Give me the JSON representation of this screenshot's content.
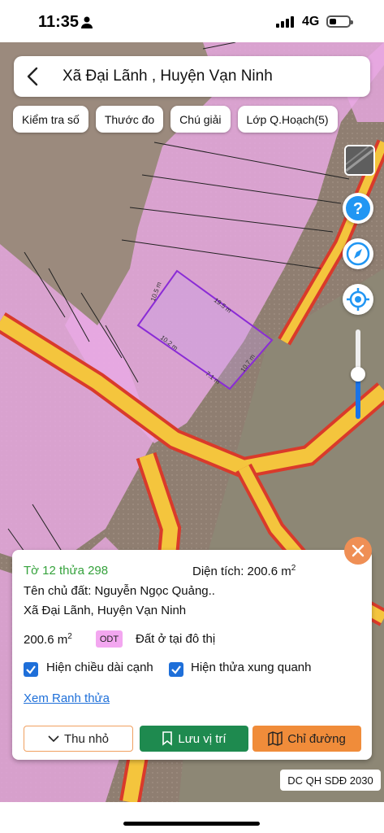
{
  "status_bar": {
    "time": "11:35",
    "network": "4G"
  },
  "header": {
    "title": "Xã Đại Lãnh , Huyện Vạn Ninh"
  },
  "toolbar_chips": [
    "Kiểm tra số",
    "Thước đo",
    "Chú giải",
    "Lớp Q.Hoạch(5)"
  ],
  "map_dimensions": [
    "10.5 m",
    "19.5 m",
    "10.2 m",
    "7.1 m",
    "10.7 m"
  ],
  "zoom_level": 0.5,
  "parcel_info": {
    "parcel_id": "Tờ 12 thửa 298",
    "area_label": "Diện tích: 200.6 m",
    "area_sup": "2",
    "owner": "Tên chủ đất: Nguyễn Ngọc Quảng..",
    "location": "Xã Đại Lãnh, Huyện Vạn Ninh",
    "land_area": "200.6 m",
    "land_area_sup": "2",
    "land_code": "ODT",
    "land_type": "Đất ở tại đô thị",
    "checkbox_edge_length": "Hiện chiều dài cạnh",
    "checkbox_surrounding": "Hiện thửa xung quanh",
    "view_boundary_link": "Xem Ranh thửa",
    "btn_collapse": "Thu nhỏ",
    "btn_save": "Lưu vị trí",
    "btn_directions": "Chỉ đường"
  },
  "plan_badge": "DC QH SDĐ 2030",
  "colors": {
    "accent": "#1e6fd9",
    "save": "#1e8a4f",
    "directions": "#f08c3a",
    "residential": "#f3a7f0"
  }
}
